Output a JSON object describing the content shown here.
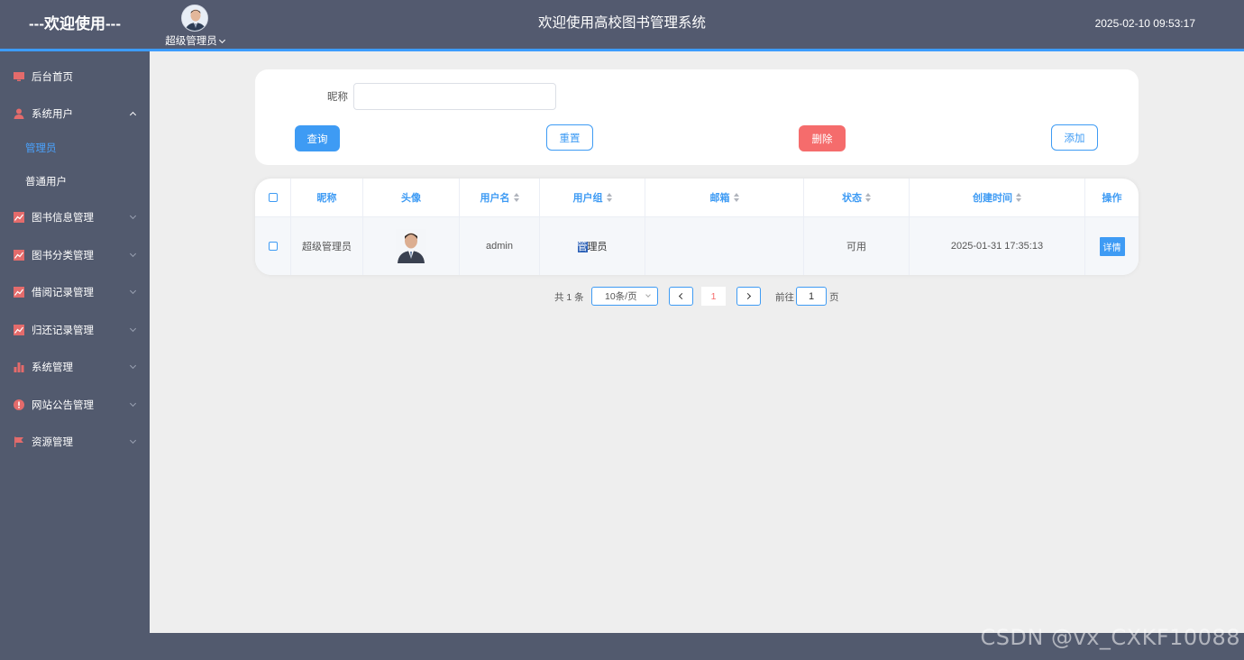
{
  "header": {
    "brand": "---欢迎使用---",
    "user_name": "超级管理员",
    "system_title": "欢迎使用高校图书管理系统",
    "datetime": "2025-02-10 09:53:17"
  },
  "sidebar": {
    "items": [
      {
        "label": "后台首页",
        "icon": "monitor-icon"
      },
      {
        "label": "系统用户",
        "icon": "user-icon",
        "expanded": true,
        "children": [
          {
            "label": "管理员",
            "active": true
          },
          {
            "label": "普通用户"
          }
        ]
      },
      {
        "label": "图书信息管理",
        "icon": "chart-line-icon"
      },
      {
        "label": "图书分类管理",
        "icon": "chart-line-icon"
      },
      {
        "label": "借阅记录管理",
        "icon": "chart-line-icon"
      },
      {
        "label": "归还记录管理",
        "icon": "chart-line-icon"
      },
      {
        "label": "系统管理",
        "icon": "bar-chart-icon"
      },
      {
        "label": "网站公告管理",
        "icon": "info-icon"
      },
      {
        "label": "资源管理",
        "icon": "flag-icon"
      }
    ],
    "icon_color": "#e46b6b"
  },
  "search": {
    "label": "昵称",
    "value": "",
    "buttons": {
      "query": "查询",
      "reset": "重置",
      "delete": "删除",
      "add": "添加"
    }
  },
  "table": {
    "columns": [
      "昵称",
      "头像",
      "用户名",
      "用户组",
      "邮箱",
      "状态",
      "创建时间",
      "操作"
    ],
    "rows": [
      {
        "nickname": "超级管理员",
        "avatar": "avatar-photo",
        "username": "admin",
        "group_selected": "管",
        "group_rest": "理员",
        "email": "",
        "status": "可用",
        "created": "2025-01-31 17:35:13",
        "action": "详情"
      }
    ]
  },
  "pagination": {
    "total": "共 1 条",
    "page_size": "10条/页",
    "current_page": "1",
    "goto_label": "前往",
    "goto_value": "1",
    "page_suffix": "页"
  },
  "watermark": "CSDN @vx_CXKF10088",
  "colors": {
    "accent": "#3e9bf4",
    "danger": "#f56c6c",
    "sidebar": "#525a6e"
  }
}
